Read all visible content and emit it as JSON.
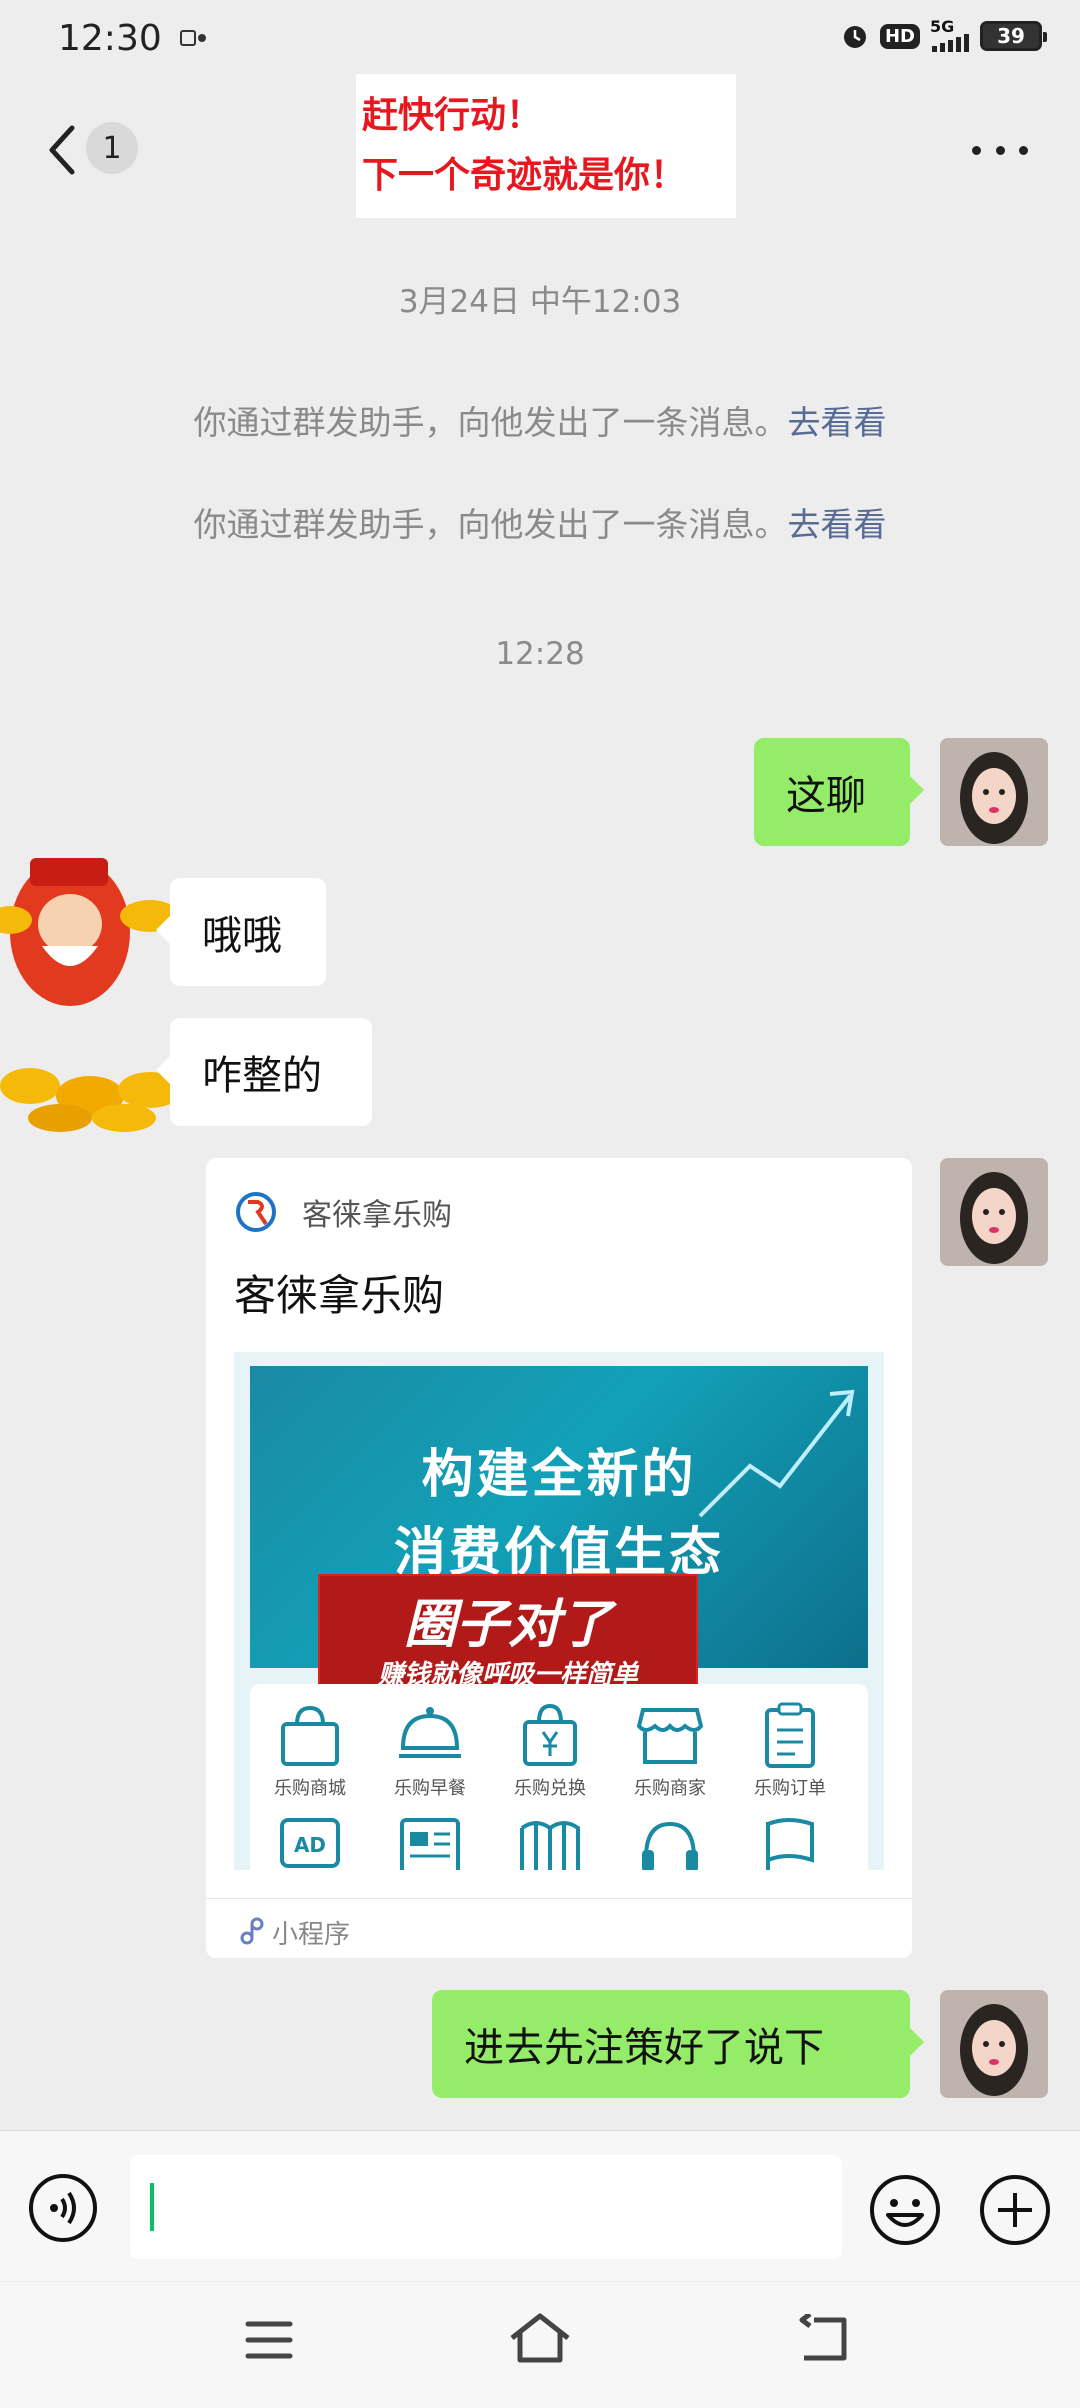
{
  "status_bar": {
    "time": "12:30",
    "network": "5G",
    "hd": "HD",
    "battery": "39"
  },
  "header": {
    "unread_count": "1",
    "banner_line1": "赶快行动！",
    "banner_line2": "下一个奇迹就是你！"
  },
  "chat": {
    "timestamp1": "3月24日 中午12:03",
    "system1_text": "你通过群发助手，向他发出了一条消息。",
    "system1_link": "去看看",
    "system2_text": "你通过群发助手，向他发出了一条消息。",
    "system2_link": "去看看",
    "timestamp2": "12:28",
    "messages": [
      {
        "side": "right",
        "text": "这聊"
      },
      {
        "side": "left",
        "text": "哦哦"
      },
      {
        "side": "left",
        "text": "咋整的"
      },
      {
        "side": "right",
        "text": "进去先注策好了说下"
      }
    ]
  },
  "card": {
    "brand": "客徕拿乐购",
    "title": "客徕拿乐购",
    "hero_line1": "构建全新的",
    "hero_line2": "消费价值生态",
    "promo_title": "圈子对了",
    "promo_sub": "赚钱就像呼吸一样简单",
    "grid_labels": [
      "乐购商城",
      "乐购早餐",
      "乐购兑换",
      "乐购商家",
      "乐购订单"
    ],
    "footer_label": "小程序"
  },
  "icons": {
    "back": "chevron-left-icon",
    "more": "more-dots-icon",
    "voice": "voice-icon",
    "emoji": "emoji-icon",
    "plus": "plus-icon"
  },
  "colors": {
    "bubble_green": "#95ec69",
    "link": "#576b95",
    "banner_red": "#e8161e",
    "background": "#ededed"
  }
}
